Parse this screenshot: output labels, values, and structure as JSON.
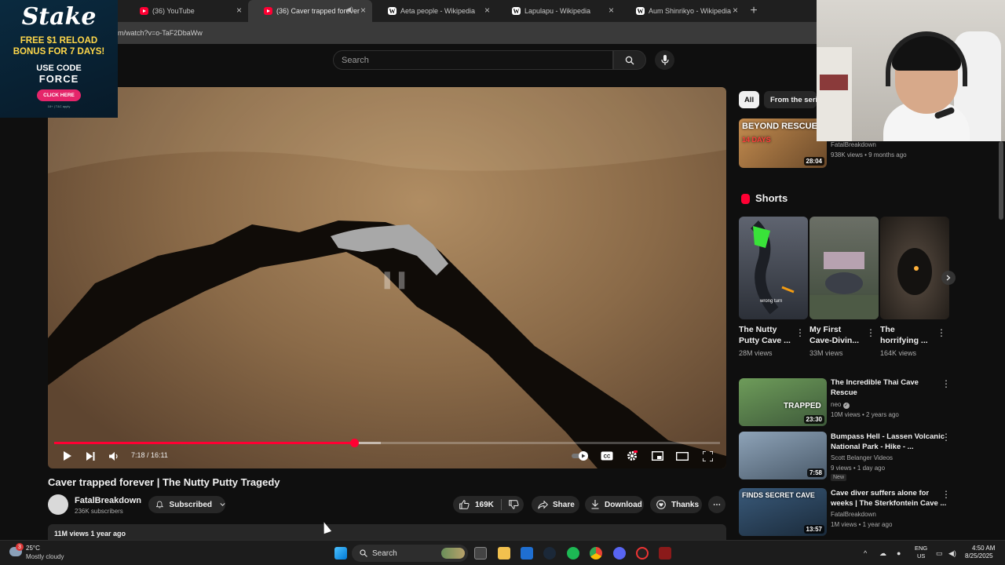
{
  "browser": {
    "tabs": [
      {
        "label": "",
        "favicon": "ad-covered",
        "active": false
      },
      {
        "label": "(36) YouTube",
        "favicon": "youtube-icon",
        "active": false
      },
      {
        "label": "(36) Caver trapped forever",
        "favicon": "youtube-icon",
        "active": true
      },
      {
        "label": "Aeta people - Wikipedia",
        "favicon": "wikipedia-icon",
        "active": false
      },
      {
        "label": "Lapulapu - Wikipedia",
        "favicon": "wikipedia-icon",
        "active": false
      },
      {
        "label": "Aum Shinrikyo - Wikipedia",
        "favicon": "wikipedia-icon",
        "active": false
      }
    ],
    "new_tab": "+",
    "url": "m/watch?v=o-TaF2DbaWw"
  },
  "ad": {
    "logo": "Stake",
    "promo_line1": "FREE $1 RELOAD",
    "promo_line2": "BONUS FOR 7 DAYS!",
    "code_line1": "USE CODE",
    "code_line2": "FORCE",
    "cta": "CLICK HERE",
    "fine_print": "18+ | T&C apply"
  },
  "search": {
    "placeholder": "Search"
  },
  "player": {
    "time_current": "7:18",
    "time_total": "16:11",
    "time_display": "7:18 / 16:11",
    "played_fraction": 0.451,
    "buffered_fraction": 0.49
  },
  "video": {
    "title": "Caver trapped forever | The Nutty Putty Tragedy",
    "channel": "FatalBreakdown",
    "subscribers": "236K subscribers",
    "subscribed_label": "Subscribed",
    "likes": "169K",
    "share_label": "Share",
    "download_label": "Download",
    "thanks_label": "Thanks",
    "meta": "11M views  1 year ago"
  },
  "sidebar": {
    "chips": [
      "All",
      "From the series"
    ],
    "top_video": {
      "thumb_text": "BEYOND RESCUE",
      "thumb_sub": "14 DAYS",
      "duration": "28:04",
      "channel": "FatalBreakdown",
      "meta": "938K views • 9 months ago"
    },
    "shorts_heading": "Shorts",
    "shorts": [
      {
        "title_line1": "The Nutty",
        "title_line2": "Putty Cave ...",
        "views": "28M views",
        "thumb_label": "wrong turn"
      },
      {
        "title_line1": "My First",
        "title_line2": "Cave-Divin...",
        "views": "33M views",
        "thumb_label": ""
      },
      {
        "title_line1": "The",
        "title_line2": "horrifying ...",
        "views": "164K views",
        "thumb_label": ""
      }
    ],
    "videos": [
      {
        "title_line1": "The Incredible Thai Cave",
        "title_line2": "Rescue",
        "channel": "neo",
        "meta": "10M views • 2 years ago",
        "duration": "23:30",
        "thumb_text": "TRAPPED",
        "badge": ""
      },
      {
        "title_line1": "Bumpass Hell - Lassen Volcanic",
        "title_line2": "National Park - Hike - ...",
        "channel": "Scott Belanger Videos",
        "meta": "9 views • 1 day ago",
        "duration": "7:58",
        "thumb_text": "",
        "badge": "New"
      },
      {
        "title_line1": "Cave diver suffers alone for",
        "title_line2": "weeks | The Sterkfontein Cave ...",
        "channel": "FatalBreakdown",
        "meta": "1M views • 1 year ago",
        "duration": "13:57",
        "thumb_text": "FINDS SECRET CAVE",
        "badge": ""
      }
    ]
  },
  "taskbar": {
    "weather_temp": "25°C",
    "weather_desc": "Mostly cloudy",
    "weather_badge": "3",
    "search_label": "Search",
    "lang1": "ENG",
    "lang2": "US",
    "time": "4:50 AM",
    "date": "8/25/2025"
  },
  "colors": {
    "accent": "#ff0033",
    "background": "#0f0f0f",
    "surface": "#272727"
  }
}
